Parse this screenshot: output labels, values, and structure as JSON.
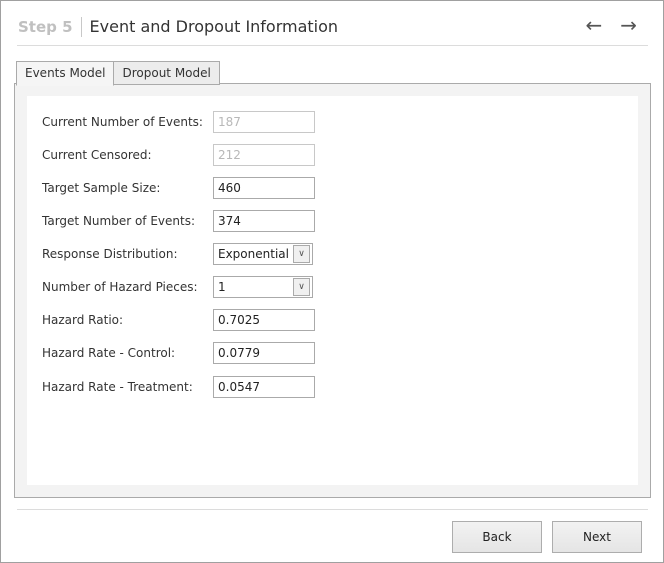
{
  "header": {
    "step": "Step 5",
    "title": "Event and Dropout Information",
    "back_arrow": "←",
    "forward_arrow": "→"
  },
  "tabs": [
    {
      "label": "Events Model",
      "active": true
    },
    {
      "label": "Dropout Model",
      "active": false
    }
  ],
  "form": {
    "fields": [
      {
        "label": "Current Number of Events:",
        "value": "187",
        "disabled": true
      },
      {
        "label": "Current Censored:",
        "value": "212",
        "disabled": true
      },
      {
        "label": "Target Sample Size:",
        "value": "460"
      },
      {
        "label": "Target Number of Events:",
        "value": "374"
      },
      {
        "label": "Response Distribution:",
        "value": "Exponential",
        "type": "select"
      },
      {
        "label": "Number of Hazard Pieces:",
        "value": "1",
        "type": "select"
      },
      {
        "label": "Hazard Ratio:",
        "value": "0.7025"
      },
      {
        "label": "Hazard Rate - Control:",
        "value": "0.0779"
      },
      {
        "label": "Hazard Rate - Treatment:",
        "value": "0.0547"
      }
    ],
    "dropdown_glyph": "∨"
  },
  "footer": {
    "back_label": "Back",
    "next_label": "Next"
  }
}
